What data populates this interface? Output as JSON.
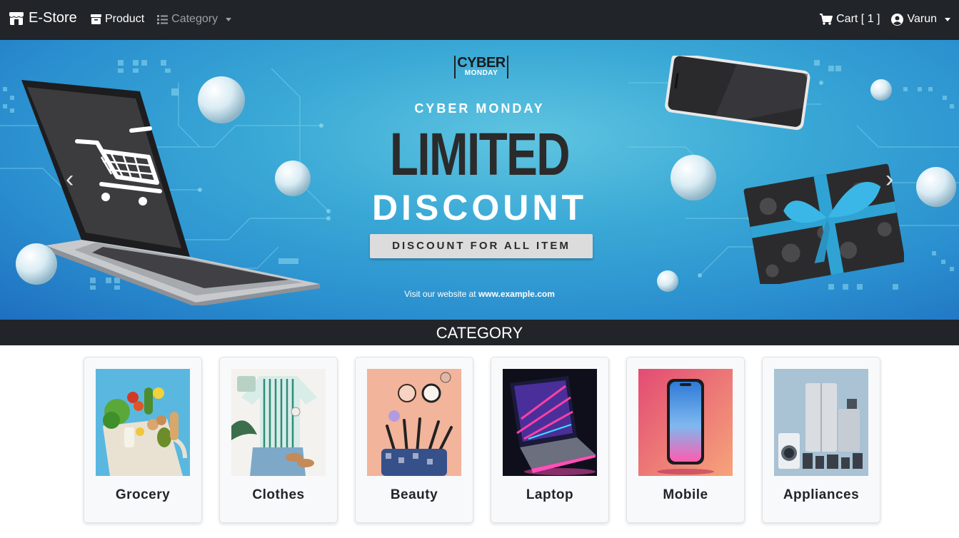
{
  "navbar": {
    "brand": "E-Store",
    "links": [
      {
        "label": "Product",
        "icon": "box-icon"
      },
      {
        "label": "Category",
        "icon": "list-icon"
      }
    ],
    "cart_label": "Cart [ 1 ]",
    "user_label": "Varun"
  },
  "hero": {
    "logo_top": "CYBER",
    "logo_bottom": "MONDAY",
    "subtitle": "CYBER MONDAY",
    "headline": "LIMITED",
    "headline2": "DISCOUNT",
    "button_label": "DISCOUNT FOR ALL ITEM",
    "visit_prefix": "Visit our website at ",
    "visit_url": "www.example.com",
    "prev_label": "‹",
    "next_label": "›"
  },
  "category_header": "CATEGORY",
  "categories": [
    {
      "name": "Grocery"
    },
    {
      "name": "Clothes"
    },
    {
      "name": "Beauty"
    },
    {
      "name": "Laptop"
    },
    {
      "name": "Mobile"
    },
    {
      "name": "Appliances"
    }
  ],
  "colors": {
    "navbar": "#212529",
    "hero_blue": "#2a8fcf",
    "card_bg": "#f8f9fa"
  }
}
